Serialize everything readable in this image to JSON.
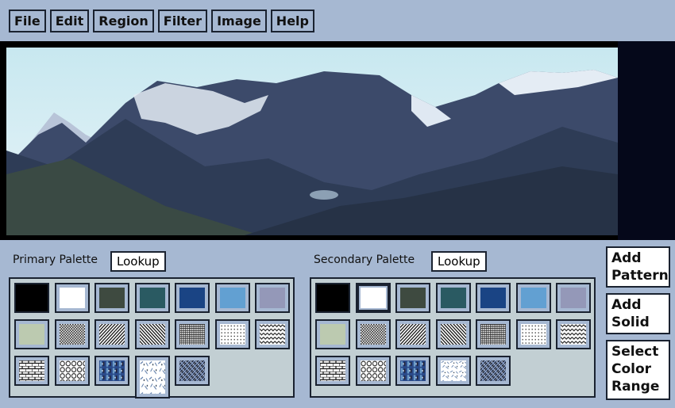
{
  "menu": [
    "File",
    "Edit",
    "Region",
    "Filter",
    "Image",
    "Help"
  ],
  "image": {
    "description_icon": "mountain-landscape-image"
  },
  "primary": {
    "label": "Primary Palette",
    "lookup": "Lookup",
    "selected_index": 17
  },
  "secondary": {
    "label": "Secondary Palette",
    "lookup": "Lookup",
    "selected_index": 1
  },
  "swatches": [
    {
      "type": "solid",
      "color": "#000000"
    },
    {
      "type": "solid",
      "color": "#ffffff"
    },
    {
      "type": "solid",
      "color": "#3e4a40"
    },
    {
      "type": "solid",
      "color": "#2a5a62"
    },
    {
      "type": "solid",
      "color": "#1a4484"
    },
    {
      "type": "solid",
      "color": "#62a0d2"
    },
    {
      "type": "solid",
      "color": "#9498b8"
    },
    {
      "type": "solid",
      "color": "#bccab0"
    },
    {
      "type": "pattern",
      "name": "checker"
    },
    {
      "type": "pattern",
      "name": "diagonal-right"
    },
    {
      "type": "pattern",
      "name": "diagonal-left"
    },
    {
      "type": "pattern",
      "name": "grid"
    },
    {
      "type": "pattern",
      "name": "dots"
    },
    {
      "type": "pattern",
      "name": "zigzag"
    },
    {
      "type": "pattern",
      "name": "brick"
    },
    {
      "type": "pattern",
      "name": "circles"
    },
    {
      "type": "pattern",
      "name": "blue-tiles"
    },
    {
      "type": "pattern",
      "name": "scatter"
    },
    {
      "type": "pattern",
      "name": "weave"
    }
  ],
  "buttons": {
    "add_pattern": "Add Pattern",
    "add_solid": "Add Solid",
    "select_color_range": "Select Color Range"
  }
}
